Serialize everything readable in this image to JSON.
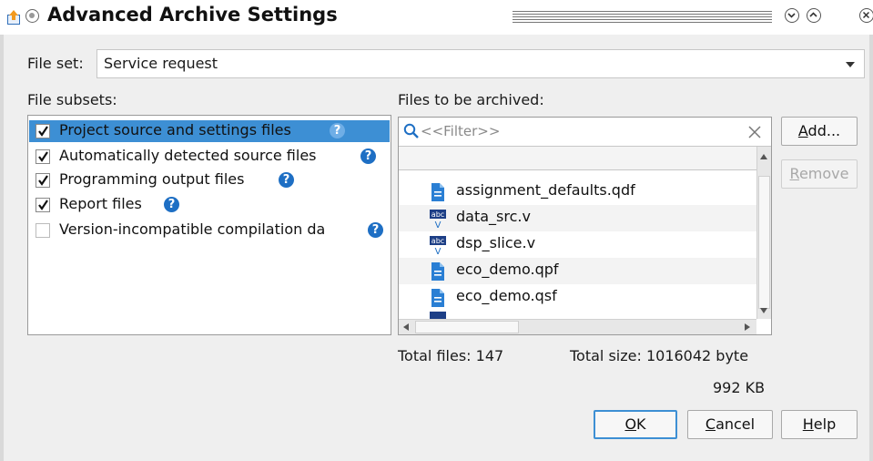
{
  "window": {
    "title": "Advanced Archive Settings"
  },
  "file_set": {
    "label": "File set:",
    "value": "Service request"
  },
  "subsets": {
    "label": "File subsets:",
    "items": [
      {
        "label": "Project source and settings files",
        "checked": true,
        "selected": true
      },
      {
        "label": "Automatically detected source files",
        "checked": true,
        "selected": false
      },
      {
        "label": "Programming output files",
        "checked": true,
        "selected": false
      },
      {
        "label": "Report files",
        "checked": true,
        "selected": false
      },
      {
        "label": "Version-incompatible compilation da",
        "checked": false,
        "selected": false
      }
    ],
    "help_icon": "question-circle-icon"
  },
  "files": {
    "label": "Files to be archived:",
    "filter_placeholder": "<<Filter>>",
    "items": [
      {
        "name": "assignment_defaults.qdf",
        "icon": "text-file-icon"
      },
      {
        "name": "data_src.v",
        "icon": "verilog-file-icon"
      },
      {
        "name": "dsp_slice.v",
        "icon": "verilog-file-icon"
      },
      {
        "name": "eco_demo.qpf",
        "icon": "text-file-icon"
      },
      {
        "name": "eco_demo.qsf",
        "icon": "text-file-icon"
      }
    ],
    "total_files": "Total files: 147",
    "total_size": "Total size: 1016042 byte",
    "size_kb": "992 KB"
  },
  "buttons": {
    "add": {
      "pre": "",
      "ul": "A",
      "post": "dd..."
    },
    "remove": {
      "pre": "",
      "ul": "R",
      "post": "emove"
    },
    "ok": {
      "pre": "",
      "ul": "O",
      "post": "K"
    },
    "cancel": {
      "pre": "",
      "ul": "C",
      "post": "ancel"
    },
    "help": {
      "pre": "",
      "ul": "H",
      "post": "elp"
    }
  },
  "colors": {
    "selection": "#3d8fd4",
    "help": "#1e6fc4",
    "file_icon": "#2a7fd4"
  }
}
